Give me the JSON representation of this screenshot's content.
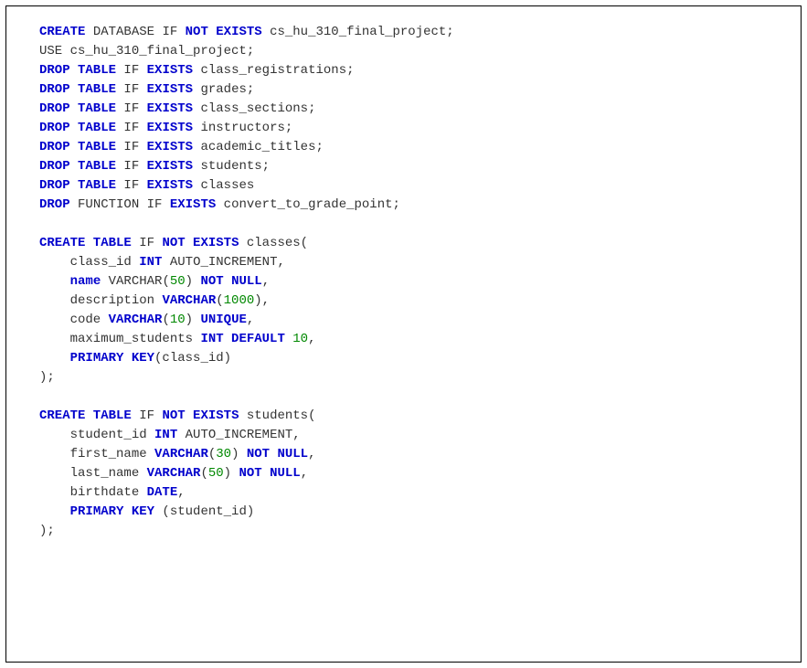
{
  "code": {
    "l1": {
      "a": "CREATE",
      "b": "DATABASE IF",
      "c": "NOT EXISTS",
      "d": "cs_hu_310_final_project;"
    },
    "l2": {
      "a": "USE cs_hu_310_final_project;"
    },
    "l3": {
      "a": "DROP TABLE",
      "b": "IF",
      "c": "EXISTS",
      "d": "class_registrations;"
    },
    "l4": {
      "a": "DROP TABLE",
      "b": "IF",
      "c": "EXISTS",
      "d": "grades;"
    },
    "l5": {
      "a": "DROP TABLE",
      "b": "IF",
      "c": "EXISTS",
      "d": "class_sections;"
    },
    "l6": {
      "a": "DROP TABLE",
      "b": "IF",
      "c": "EXISTS",
      "d": "instructors;"
    },
    "l7": {
      "a": "DROP TABLE",
      "b": "IF",
      "c": "EXISTS",
      "d": "academic_titles;"
    },
    "l8": {
      "a": "DROP TABLE",
      "b": "IF",
      "c": "EXISTS",
      "d": "students;"
    },
    "l9": {
      "a": "DROP TABLE",
      "b": "IF",
      "c": "EXISTS",
      "d": "classes"
    },
    "l10": {
      "a": "DROP",
      "b": "FUNCTION IF",
      "c": "EXISTS",
      "d": "convert_to_grade_point;"
    },
    "l12": {
      "a": "CREATE TABLE",
      "b": "IF",
      "c": "NOT EXISTS",
      "d": "classes("
    },
    "l13": {
      "a": "    class_id",
      "b": "INT",
      "c": "AUTO_INCREMENT,"
    },
    "l14": {
      "a": "    ",
      "b": "name",
      "c": "VARCHAR",
      "d": "(",
      "e": "50",
      "f": ")",
      "g": "NOT NULL",
      "h": ","
    },
    "l15": {
      "a": "    description",
      "b": "VARCHAR",
      "c": "(",
      "d": "1000",
      "e": "),"
    },
    "l16": {
      "a": "    code",
      "b": "VARCHAR",
      "c": "(",
      "d": "10",
      "e": ")",
      "f": "UNIQUE",
      "g": ","
    },
    "l17": {
      "a": "    maximum_students",
      "b": "INT DEFAULT",
      "c": "10",
      "d": ","
    },
    "l18": {
      "a": "    ",
      "b": "PRIMARY KEY",
      "c": "(class_id)"
    },
    "l19": {
      "a": ");"
    },
    "l21": {
      "a": "CREATE TABLE",
      "b": "IF",
      "c": "NOT EXISTS",
      "d": "students("
    },
    "l22": {
      "a": "    student_id",
      "b": "INT",
      "c": "AUTO_INCREMENT,"
    },
    "l23": {
      "a": "    first_name",
      "b": "VARCHAR",
      "c": "(",
      "d": "30",
      "e": ")",
      "f": "NOT NULL",
      "g": ","
    },
    "l24": {
      "a": "    last_name",
      "b": "VARCHAR",
      "c": "(",
      "d": "50",
      "e": ")",
      "f": "NOT NULL",
      "g": ","
    },
    "l25": {
      "a": "    birthdate",
      "b": "DATE",
      "c": ","
    },
    "l26": {
      "a": "    ",
      "b": "PRIMARY KEY",
      "c": " (student_id)"
    },
    "l27": {
      "a": ");"
    }
  }
}
